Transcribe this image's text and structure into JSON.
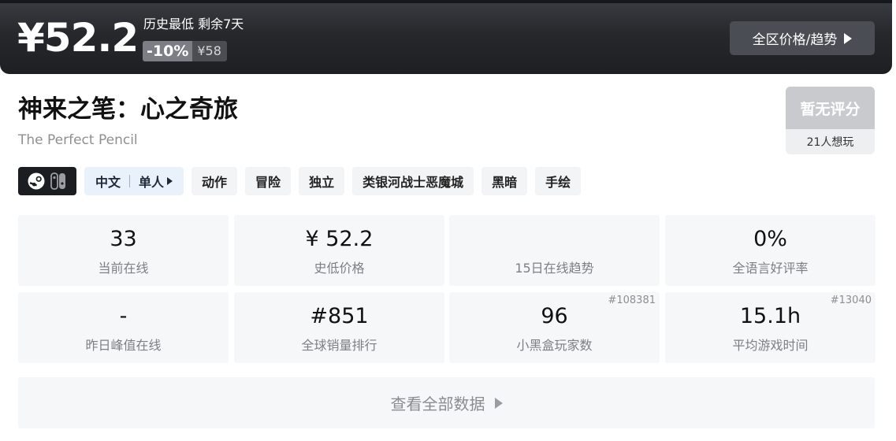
{
  "price": {
    "current": "¥52.2",
    "note": "历史最低 剩余7天",
    "discount": "-10%",
    "original": "¥58",
    "region_button": "全区价格/趋势"
  },
  "game": {
    "title_cn": "神来之笔：心之奇旅",
    "title_en": "The Perfect Pencil"
  },
  "rating": {
    "score_text": "暂无评分",
    "wishlist": "21人想玩"
  },
  "platforms": [
    "steam-icon",
    "switch-icon"
  ],
  "language": {
    "lang": "中文",
    "mode": "单人"
  },
  "tags": [
    "动作",
    "冒险",
    "独立",
    "类银河战士恶魔城",
    "黑暗",
    "手绘"
  ],
  "stats": [
    {
      "value": "33",
      "label": "当前在线",
      "rank": ""
    },
    {
      "value": "¥ 52.2",
      "label": "史低价格",
      "rank": ""
    },
    {
      "value": "",
      "label": "15日在线趋势",
      "rank": ""
    },
    {
      "value": "0%",
      "label": "全语言好评率",
      "rank": ""
    },
    {
      "value": "-",
      "label": "昨日峰值在线",
      "rank": ""
    },
    {
      "value": "#851",
      "label": "全球销量排行",
      "rank": ""
    },
    {
      "value": "96",
      "label": "小黑盒玩家数",
      "rank": "#108381"
    },
    {
      "value": "15.1h",
      "label": "平均游戏时间",
      "rank": "#13040"
    }
  ],
  "view_all": "查看全部数据",
  "colors": {
    "banner_dark": "#26282c",
    "lang_tag_bg": "#e9f1fb",
    "rating_bg": "#c8cacd",
    "stat_bg": "#f6f7f9"
  }
}
